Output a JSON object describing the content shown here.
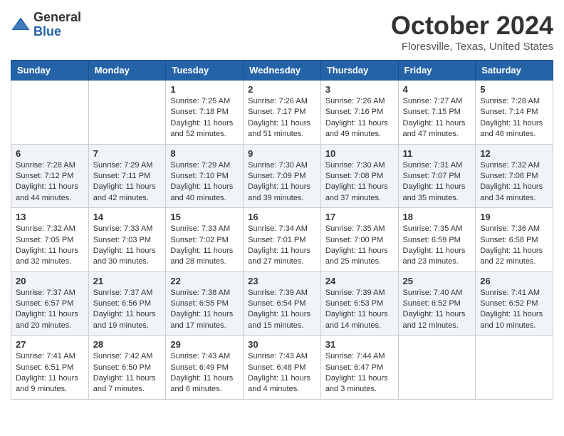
{
  "header": {
    "logo": {
      "general": "General",
      "blue": "Blue"
    },
    "title": "October 2024",
    "location": "Floresville, Texas, United States"
  },
  "days_of_week": [
    "Sunday",
    "Monday",
    "Tuesday",
    "Wednesday",
    "Thursday",
    "Friday",
    "Saturday"
  ],
  "weeks": [
    [
      {
        "day": "",
        "content": ""
      },
      {
        "day": "",
        "content": ""
      },
      {
        "day": "1",
        "content": "Sunrise: 7:25 AM\nSunset: 7:18 PM\nDaylight: 11 hours and 52 minutes."
      },
      {
        "day": "2",
        "content": "Sunrise: 7:26 AM\nSunset: 7:17 PM\nDaylight: 11 hours and 51 minutes."
      },
      {
        "day": "3",
        "content": "Sunrise: 7:26 AM\nSunset: 7:16 PM\nDaylight: 11 hours and 49 minutes."
      },
      {
        "day": "4",
        "content": "Sunrise: 7:27 AM\nSunset: 7:15 PM\nDaylight: 11 hours and 47 minutes."
      },
      {
        "day": "5",
        "content": "Sunrise: 7:28 AM\nSunset: 7:14 PM\nDaylight: 11 hours and 46 minutes."
      }
    ],
    [
      {
        "day": "6",
        "content": "Sunrise: 7:28 AM\nSunset: 7:12 PM\nDaylight: 11 hours and 44 minutes."
      },
      {
        "day": "7",
        "content": "Sunrise: 7:29 AM\nSunset: 7:11 PM\nDaylight: 11 hours and 42 minutes."
      },
      {
        "day": "8",
        "content": "Sunrise: 7:29 AM\nSunset: 7:10 PM\nDaylight: 11 hours and 40 minutes."
      },
      {
        "day": "9",
        "content": "Sunrise: 7:30 AM\nSunset: 7:09 PM\nDaylight: 11 hours and 39 minutes."
      },
      {
        "day": "10",
        "content": "Sunrise: 7:30 AM\nSunset: 7:08 PM\nDaylight: 11 hours and 37 minutes."
      },
      {
        "day": "11",
        "content": "Sunrise: 7:31 AM\nSunset: 7:07 PM\nDaylight: 11 hours and 35 minutes."
      },
      {
        "day": "12",
        "content": "Sunrise: 7:32 AM\nSunset: 7:06 PM\nDaylight: 11 hours and 34 minutes."
      }
    ],
    [
      {
        "day": "13",
        "content": "Sunrise: 7:32 AM\nSunset: 7:05 PM\nDaylight: 11 hours and 32 minutes."
      },
      {
        "day": "14",
        "content": "Sunrise: 7:33 AM\nSunset: 7:03 PM\nDaylight: 11 hours and 30 minutes."
      },
      {
        "day": "15",
        "content": "Sunrise: 7:33 AM\nSunset: 7:02 PM\nDaylight: 11 hours and 28 minutes."
      },
      {
        "day": "16",
        "content": "Sunrise: 7:34 AM\nSunset: 7:01 PM\nDaylight: 11 hours and 27 minutes."
      },
      {
        "day": "17",
        "content": "Sunrise: 7:35 AM\nSunset: 7:00 PM\nDaylight: 11 hours and 25 minutes."
      },
      {
        "day": "18",
        "content": "Sunrise: 7:35 AM\nSunset: 6:59 PM\nDaylight: 11 hours and 23 minutes."
      },
      {
        "day": "19",
        "content": "Sunrise: 7:36 AM\nSunset: 6:58 PM\nDaylight: 11 hours and 22 minutes."
      }
    ],
    [
      {
        "day": "20",
        "content": "Sunrise: 7:37 AM\nSunset: 6:57 PM\nDaylight: 11 hours and 20 minutes."
      },
      {
        "day": "21",
        "content": "Sunrise: 7:37 AM\nSunset: 6:56 PM\nDaylight: 11 hours and 19 minutes."
      },
      {
        "day": "22",
        "content": "Sunrise: 7:38 AM\nSunset: 6:55 PM\nDaylight: 11 hours and 17 minutes."
      },
      {
        "day": "23",
        "content": "Sunrise: 7:39 AM\nSunset: 6:54 PM\nDaylight: 11 hours and 15 minutes."
      },
      {
        "day": "24",
        "content": "Sunrise: 7:39 AM\nSunset: 6:53 PM\nDaylight: 11 hours and 14 minutes."
      },
      {
        "day": "25",
        "content": "Sunrise: 7:40 AM\nSunset: 6:52 PM\nDaylight: 11 hours and 12 minutes."
      },
      {
        "day": "26",
        "content": "Sunrise: 7:41 AM\nSunset: 6:52 PM\nDaylight: 11 hours and 10 minutes."
      }
    ],
    [
      {
        "day": "27",
        "content": "Sunrise: 7:41 AM\nSunset: 6:51 PM\nDaylight: 11 hours and 9 minutes."
      },
      {
        "day": "28",
        "content": "Sunrise: 7:42 AM\nSunset: 6:50 PM\nDaylight: 11 hours and 7 minutes."
      },
      {
        "day": "29",
        "content": "Sunrise: 7:43 AM\nSunset: 6:49 PM\nDaylight: 11 hours and 6 minutes."
      },
      {
        "day": "30",
        "content": "Sunrise: 7:43 AM\nSunset: 6:48 PM\nDaylight: 11 hours and 4 minutes."
      },
      {
        "day": "31",
        "content": "Sunrise: 7:44 AM\nSunset: 6:47 PM\nDaylight: 11 hours and 3 minutes."
      },
      {
        "day": "",
        "content": ""
      },
      {
        "day": "",
        "content": ""
      }
    ]
  ]
}
